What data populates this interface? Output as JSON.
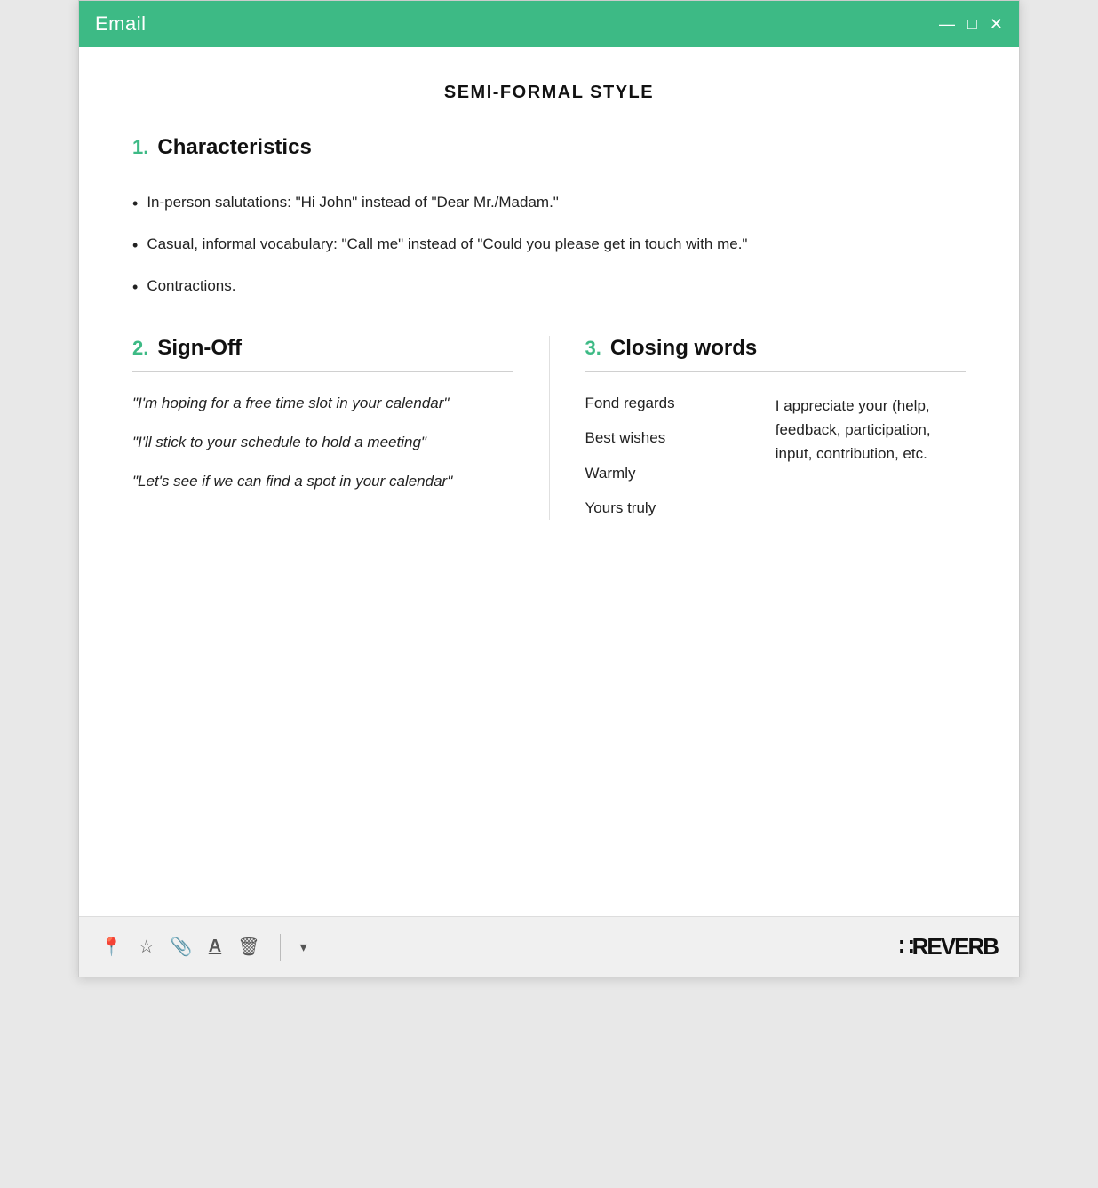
{
  "window": {
    "title": "Email",
    "controls": {
      "minimize": "—",
      "maximize": "□",
      "close": "✕"
    }
  },
  "page": {
    "title": "SEMI-FORMAL STYLE"
  },
  "section1": {
    "number": "1.",
    "title": "Characteristics",
    "bullets": [
      "In-person salutations: \"Hi John\" instead of \"Dear Mr./Madam.\"",
      "Casual, informal vocabulary: \"Call me\" instead of \"Could you please get in touch with me.\"",
      "Contractions."
    ]
  },
  "section2": {
    "number": "2.",
    "title": "Sign-Off",
    "quotes": [
      "\"I'm hoping for a free time slot in your calendar\"",
      "\"I'll stick to your schedule to hold a meeting\"",
      "\"Let's see if we can find a spot in your calendar\""
    ]
  },
  "section3": {
    "number": "3.",
    "title": "Closing words",
    "words": [
      "Fond regards",
      "Best wishes",
      "Warmly",
      "Yours truly"
    ],
    "description": "I appreciate your (help, feedback, participation, input, contribution, etc."
  },
  "footer": {
    "logo": "\"REVERB",
    "dropdown_label": "▾"
  }
}
